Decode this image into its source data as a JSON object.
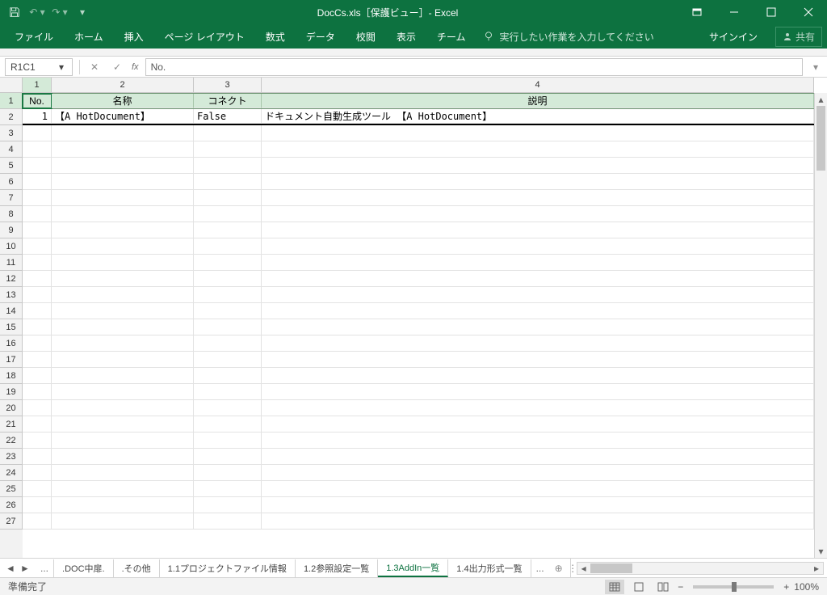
{
  "title": "DocCs.xls［保護ビュー］- Excel",
  "qat": {
    "undo": "↶",
    "redo": "↷"
  },
  "ribbon": {
    "tabs": [
      "ファイル",
      "ホーム",
      "挿入",
      "ページ レイアウト",
      "数式",
      "データ",
      "校閲",
      "表示",
      "チーム"
    ],
    "tellme": "実行したい作業を入力してください",
    "signin": "サインイン",
    "share": "共有"
  },
  "namebox": "R1C1",
  "formula": "No.",
  "colHeaders": [
    "1",
    "2",
    "3",
    "4"
  ],
  "headers": {
    "c1": "No.",
    "c2": "名称",
    "c3": "コネクト",
    "c4": "説明"
  },
  "row2": {
    "c1": "1",
    "c2": "【A HotDocument】",
    "c3": "False",
    "c4": "ドキュメント自動生成ツール 【A HotDocument】"
  },
  "sheetTabs": {
    "nav_more": "...",
    "t1": ".DOC中扉.",
    "t2": ".その他",
    "t3": "1.1プロジェクトファイル情報",
    "t4": "1.2参照設定一覧",
    "t5": "1.3AddIn一覧",
    "t6": "1.4出力形式一覧",
    "more": "..."
  },
  "status": {
    "ready": "準備完了",
    "zoom": "100%",
    "minus": "−",
    "plus": "+"
  }
}
